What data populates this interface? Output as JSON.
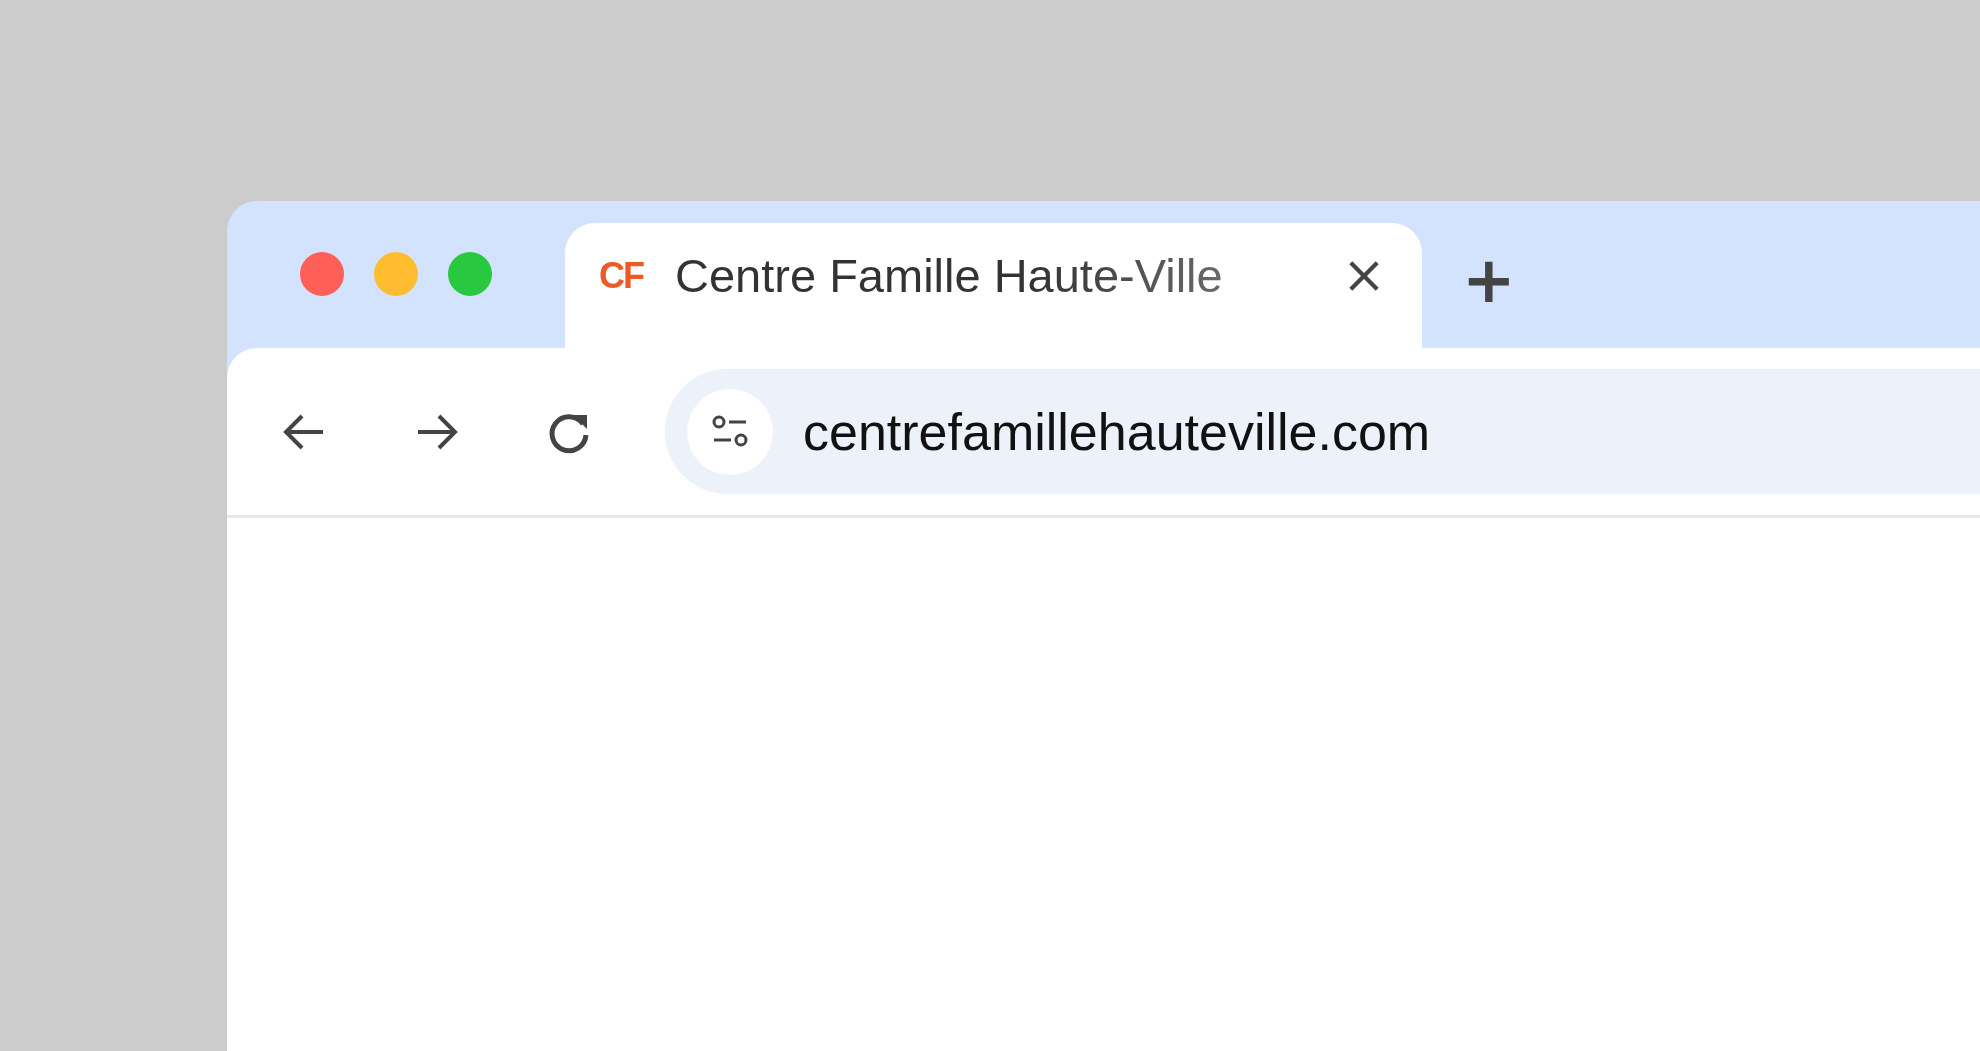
{
  "window_controls": [
    {
      "color": "#ff5f57"
    },
    {
      "color": "#febc2e"
    },
    {
      "color": "#28c840"
    }
  ],
  "tabs": [
    {
      "favicon": "CF",
      "title": "Centre Famille Haute-Ville",
      "selected": true
    }
  ],
  "new_tab": "+",
  "address_bar": {
    "value": "centrefamillehauteville.com"
  }
}
